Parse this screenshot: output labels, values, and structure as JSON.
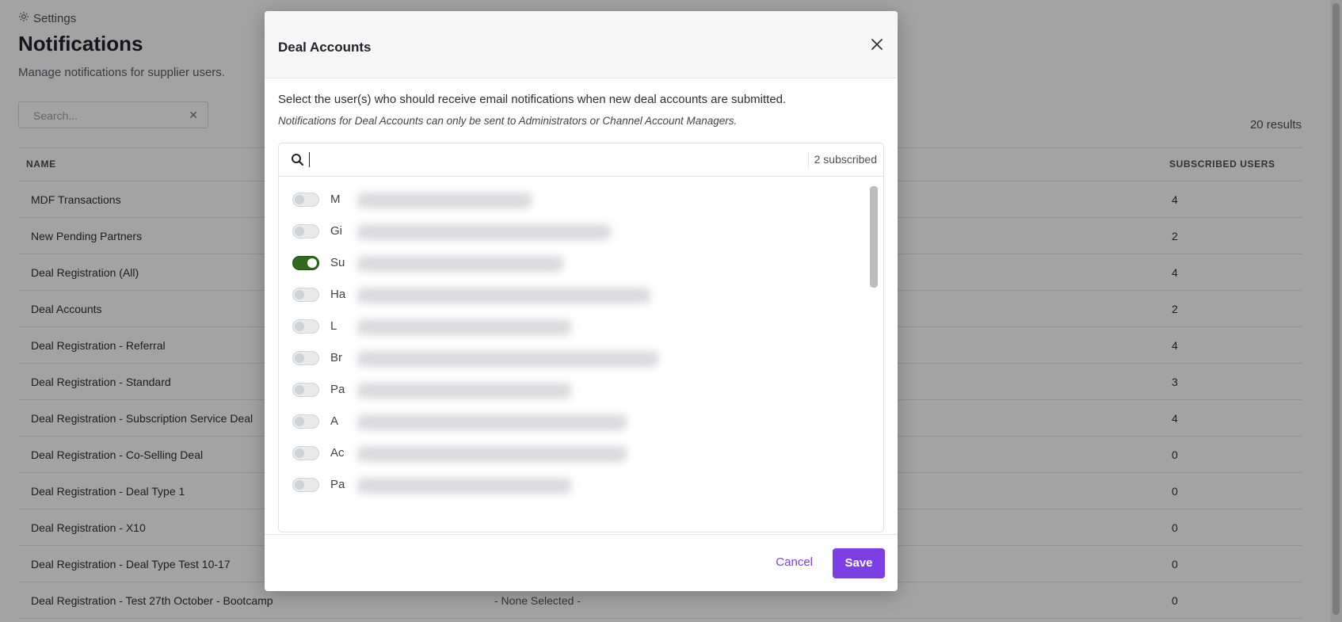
{
  "page": {
    "breadcrumb": "Settings",
    "title": "Notifications",
    "subtitle": "Manage notifications for supplier users.",
    "search_placeholder": "Search...",
    "results": "20 results",
    "columns": {
      "name": "NAME",
      "subscribed": "SUBSCRIBED USERS"
    },
    "rows": [
      {
        "name": "MDF Transactions",
        "status": "",
        "count": "4"
      },
      {
        "name": "New Pending Partners",
        "status": "",
        "count": "2"
      },
      {
        "name": "Deal Registration (All)",
        "status": "",
        "count": "4"
      },
      {
        "name": "Deal Accounts",
        "status": "",
        "count": "2"
      },
      {
        "name": "Deal Registration - Referral",
        "status": "",
        "count": "4"
      },
      {
        "name": "Deal Registration - Standard",
        "status": "",
        "count": "3"
      },
      {
        "name": "Deal Registration - Subscription Service Deal",
        "status": "",
        "count": "4"
      },
      {
        "name": "Deal Registration - Co-Selling Deal",
        "status": "",
        "count": "0"
      },
      {
        "name": "Deal Registration - Deal Type 1",
        "status": "",
        "count": "0"
      },
      {
        "name": "Deal Registration - X10",
        "status": "",
        "count": "0"
      },
      {
        "name": "Deal Registration - Deal Type Test 10-17",
        "status": "",
        "count": "0"
      },
      {
        "name": "Deal Registration - Test 27th October - Bootcamp",
        "status": "- None Selected -",
        "count": "0"
      }
    ]
  },
  "modal": {
    "title": "Deal Accounts",
    "description": "Select the user(s) who should receive email notifications when new deal accounts are submitted.",
    "note": "Notifications for Deal Accounts can only be sent to Administrators or Channel Account Managers.",
    "search_value": "",
    "subscribed_count": "2 subscribed",
    "users": [
      {
        "initial": "M",
        "on": false
      },
      {
        "initial": "Gi",
        "on": false
      },
      {
        "initial": "Su",
        "on": true
      },
      {
        "initial": "Ha",
        "on": false
      },
      {
        "initial": "L",
        "on": false
      },
      {
        "initial": "Br",
        "on": false
      },
      {
        "initial": "Pa",
        "on": false
      },
      {
        "initial": "A",
        "on": false
      },
      {
        "initial": "Ac",
        "on": false
      },
      {
        "initial": "Pa",
        "on": false
      }
    ],
    "cancel_label": "Cancel",
    "save_label": "Save"
  },
  "colors": {
    "accent": "#7b3fe4",
    "toggle_on": "#2f6a1e",
    "overlay": "rgba(0,0,0,0.36)"
  },
  "icons": {
    "breadcrumb": "gear-icon",
    "close": "close-icon",
    "search": "search-icon",
    "clear": "clear-icon"
  }
}
